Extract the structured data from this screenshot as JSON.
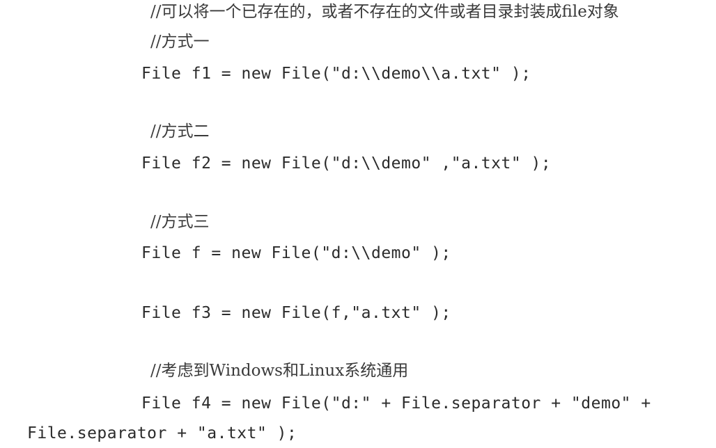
{
  "lines": [
    {
      "text": "//可以将一个已存在的，或者不存在的文件或者目录封装成file对象"
    },
    {
      "text": "//方式一"
    },
    {
      "text": "File f1 = new File(\"d:\\\\demo\\\\a.txt\" );"
    },
    {
      "text": "//方式二"
    },
    {
      "text": "File f2 = new File(\"d:\\\\demo\" ,\"a.txt\" );"
    },
    {
      "text": "//方式三"
    },
    {
      "text": "File f = new File(\"d:\\\\demo\" );"
    },
    {
      "text": "File f3 = new File(f,\"a.txt\" );"
    },
    {
      "text": "//考虑到Windows和Linux系统通用"
    },
    {
      "text": "File f4 = new File(\"d:\" + File.separator + \"demo\" +"
    },
    {
      "text": "File.separator + \"a.txt\" );"
    }
  ]
}
